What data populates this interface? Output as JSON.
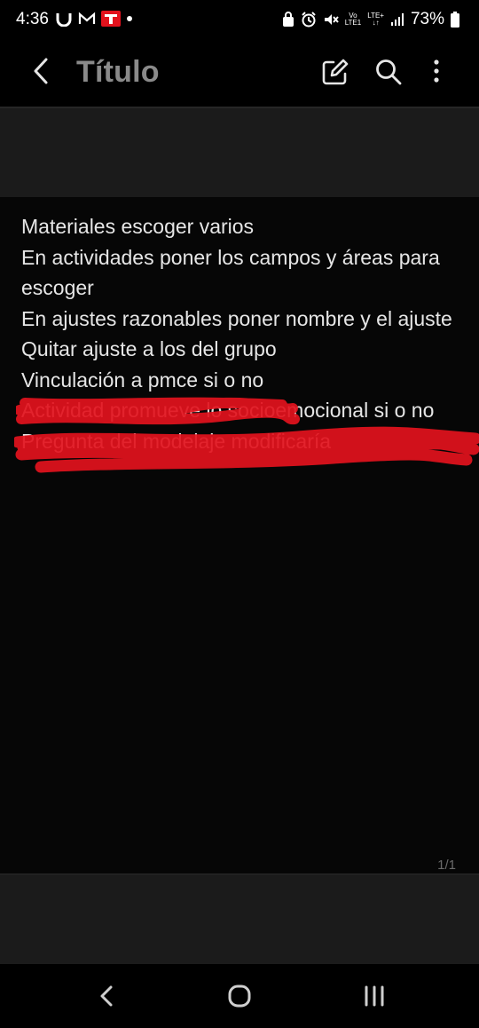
{
  "status_bar": {
    "time": "4:36",
    "battery": "73%",
    "network": "LTE+",
    "volte": "Vo",
    "lte1": "LTE1"
  },
  "app_bar": {
    "title": "Título",
    "icons": [
      "back-icon",
      "edit-icon",
      "search-icon",
      "more-vertical-icon"
    ]
  },
  "note": {
    "lines": [
      "Materiales escoger varios",
      "En actividades poner los campos y áreas para escoger",
      "En ajustes razonables poner nombre y el ajuste",
      "Quitar ajuste a los del grupo",
      "Vinculación a pmce si o no",
      "Actividad promueve lo socioemocional si o no",
      "Pregunta del modelaje modificaría"
    ],
    "scribble_color": "#e3121d"
  },
  "page_counter": "1/1",
  "nav": {
    "icons": [
      "nav-back-icon",
      "home-icon",
      "recents-icon"
    ]
  }
}
